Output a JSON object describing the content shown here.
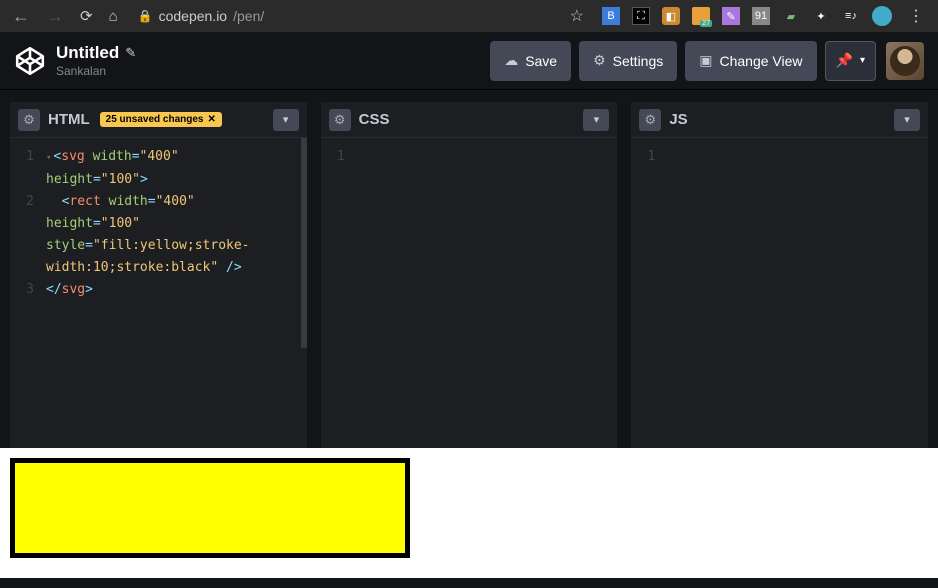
{
  "browser": {
    "url_host": "codepen.io",
    "url_path": "/pen/",
    "ext_badge": "27"
  },
  "header": {
    "title": "Untitled",
    "author": "Sankalan",
    "buttons": {
      "save": "Save",
      "settings": "Settings",
      "change_view": "Change View"
    }
  },
  "panes": {
    "html": {
      "title": "HTML",
      "badge": "25 unsaved changes",
      "badge_x": "✕",
      "code": [
        {
          "num": "1",
          "fold": true,
          "parts": [
            {
              "t": "<",
              "c": "tok-punc"
            },
            {
              "t": "svg",
              "c": "tok-tag"
            },
            {
              "t": " ",
              "c": ""
            },
            {
              "t": "width",
              "c": "tok-attr"
            },
            {
              "t": "=",
              "c": "tok-op"
            },
            {
              "t": "\"400\"",
              "c": "tok-str"
            },
            {
              "t": " ",
              "c": ""
            }
          ]
        },
        {
          "num": "",
          "parts": [
            {
              "t": "height",
              "c": "tok-attr"
            },
            {
              "t": "=",
              "c": "tok-op"
            },
            {
              "t": "\"100\"",
              "c": "tok-str"
            },
            {
              "t": ">",
              "c": "tok-punc"
            }
          ]
        },
        {
          "num": "2",
          "parts": [
            {
              "t": "  ",
              "c": ""
            },
            {
              "t": "<",
              "c": "tok-punc"
            },
            {
              "t": "rect",
              "c": "tok-tag"
            },
            {
              "t": " ",
              "c": ""
            },
            {
              "t": "width",
              "c": "tok-attr"
            },
            {
              "t": "=",
              "c": "tok-op"
            },
            {
              "t": "\"400\"",
              "c": "tok-str"
            },
            {
              "t": " ",
              "c": ""
            }
          ]
        },
        {
          "num": "",
          "parts": [
            {
              "t": "height",
              "c": "tok-attr"
            },
            {
              "t": "=",
              "c": "tok-op"
            },
            {
              "t": "\"100\"",
              "c": "tok-str"
            },
            {
              "t": " ",
              "c": ""
            }
          ]
        },
        {
          "num": "",
          "parts": [
            {
              "t": "style",
              "c": "tok-attr"
            },
            {
              "t": "=",
              "c": "tok-op"
            },
            {
              "t": "\"fill:yellow;stroke-",
              "c": "tok-str"
            }
          ]
        },
        {
          "num": "",
          "parts": [
            {
              "t": "width:10;stroke:black\"",
              "c": "tok-str"
            },
            {
              "t": " />",
              "c": "tok-punc"
            }
          ]
        },
        {
          "num": "3",
          "parts": [
            {
              "t": "</",
              "c": "tok-punc"
            },
            {
              "t": "svg",
              "c": "tok-tag"
            },
            {
              "t": ">",
              "c": "tok-punc"
            }
          ]
        }
      ]
    },
    "css": {
      "title": "CSS",
      "empty_line": "1"
    },
    "js": {
      "title": "JS",
      "empty_line": "1"
    }
  },
  "preview": {
    "svg_width": "400",
    "svg_height": "100",
    "rect_fill": "yellow",
    "rect_stroke": "black",
    "rect_stroke_width": "10"
  }
}
